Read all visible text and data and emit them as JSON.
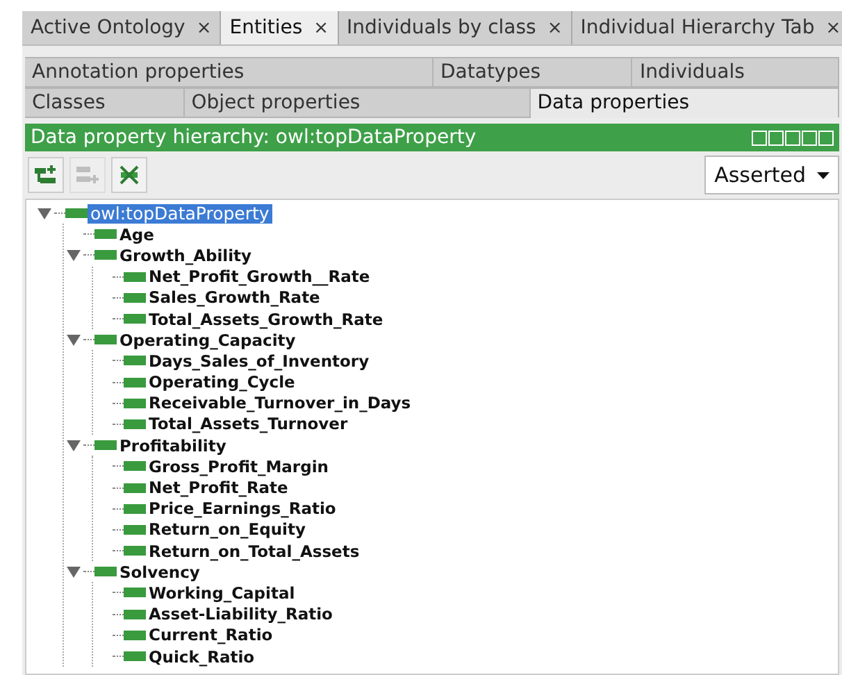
{
  "tabs": [
    {
      "label": "Active Ontology",
      "close": "×",
      "selected": false
    },
    {
      "label": "Entities",
      "close": "×",
      "selected": true
    },
    {
      "label": "Individuals by class",
      "close": "×",
      "selected": false
    },
    {
      "label": "Individual Hierarchy Tab",
      "close": "×",
      "selected": false
    }
  ],
  "entity_tabs": [
    [
      {
        "label": "Annotation properties",
        "selected": false
      },
      {
        "label": "Datatypes",
        "selected": false
      },
      {
        "label": "Individuals",
        "selected": false
      }
    ],
    [
      {
        "label": "Classes",
        "selected": false
      },
      {
        "label": "Object properties",
        "selected": false
      },
      {
        "label": "Data properties",
        "selected": true
      }
    ]
  ],
  "view": {
    "title": "Data property hierarchy: owl:topDataProperty",
    "toolbar": [
      {
        "kind": "add-sub",
        "disabled": false
      },
      {
        "kind": "add-sibling",
        "disabled": true
      },
      {
        "kind": "delete",
        "disabled": false
      }
    ],
    "mode": "Asserted",
    "tree": [
      {
        "label": "owl:topDataProperty",
        "selected": true,
        "expanded": true,
        "children": [
          {
            "label": "Age",
            "selected": false
          },
          {
            "label": "Growth_Ability",
            "selected": false,
            "expanded": true,
            "children": [
              {
                "label": "Net_Profit_Growth__Rate",
                "selected": false
              },
              {
                "label": "Sales_Growth_Rate",
                "selected": false
              },
              {
                "label": "Total_Assets_Growth_Rate",
                "selected": false
              }
            ]
          },
          {
            "label": "Operating_Capacity",
            "selected": false,
            "expanded": true,
            "children": [
              {
                "label": "Days_Sales_of_Inventory",
                "selected": false
              },
              {
                "label": "Operating_Cycle",
                "selected": false
              },
              {
                "label": "Receivable_Turnover_in_Days",
                "selected": false
              },
              {
                "label": "Total_Assets_Turnover",
                "selected": false
              }
            ]
          },
          {
            "label": "Profitability",
            "selected": false,
            "expanded": true,
            "children": [
              {
                "label": "Gross_Profit_Margin",
                "selected": false
              },
              {
                "label": "Net_Profit_Rate",
                "selected": false
              },
              {
                "label": "Price_Earnings_Ratio",
                "selected": false
              },
              {
                "label": "Return_on_Equity",
                "selected": false
              },
              {
                "label": "Return_on_Total_Assets",
                "selected": false
              }
            ]
          },
          {
            "label": "Solvency",
            "selected": false,
            "expanded": true,
            "children": [
              {
                "label": "Working_Capital",
                "selected": false
              },
              {
                "label": "Asset-Liability_Ratio",
                "selected": false
              },
              {
                "label": "Current_Ratio",
                "selected": false
              },
              {
                "label": "Quick_Ratio",
                "selected": false
              }
            ]
          }
        ]
      }
    ]
  }
}
